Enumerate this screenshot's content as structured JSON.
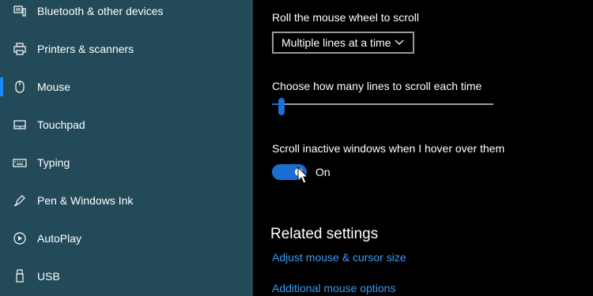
{
  "sidebar": {
    "items": [
      {
        "label": "Bluetooth & other devices",
        "icon": "bluetooth-devices-icon"
      },
      {
        "label": "Printers & scanners",
        "icon": "printer-icon"
      },
      {
        "label": "Mouse",
        "icon": "mouse-icon",
        "active": true
      },
      {
        "label": "Touchpad",
        "icon": "touchpad-icon"
      },
      {
        "label": "Typing",
        "icon": "keyboard-icon"
      },
      {
        "label": "Pen & Windows Ink",
        "icon": "pen-icon"
      },
      {
        "label": "AutoPlay",
        "icon": "autoplay-icon"
      },
      {
        "label": "USB",
        "icon": "usb-icon"
      }
    ]
  },
  "main": {
    "scroll_wheel_label": "Roll the mouse wheel to scroll",
    "scroll_wheel_value": "Multiple lines at a time",
    "lines_label": "Choose how many lines to scroll each time",
    "lines_slider_fraction": 0.03,
    "inactive_label": "Scroll inactive windows when I hover over them",
    "inactive_state": "On",
    "related_title": "Related settings",
    "links": [
      "Adjust mouse & cursor size",
      "Additional mouse options"
    ]
  },
  "colors": {
    "sidebar_bg": "#224a58",
    "accent": "#1a6fd0",
    "link": "#3a9cf3"
  }
}
